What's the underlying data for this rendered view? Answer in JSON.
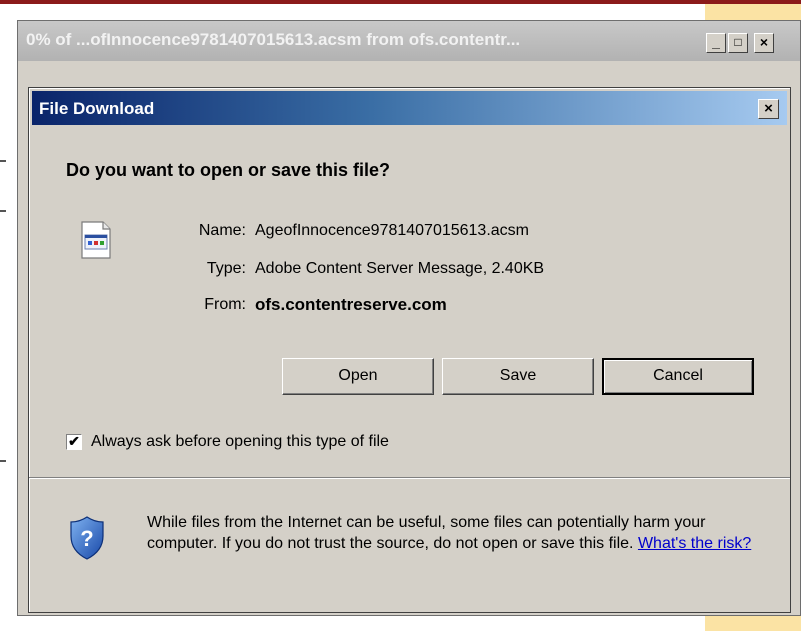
{
  "outer_window": {
    "title": "0% of ...ofInnocence9781407015613.acsm from ofs.contentr...",
    "minimize_label": "_",
    "maximize_label": "□",
    "close_label": "×"
  },
  "dialog": {
    "title": "File Download",
    "close_label": "×",
    "question": "Do you want to open or save this file?",
    "file": {
      "name_label": "Name:",
      "name_value": "AgeofInnocence9781407015613.acsm",
      "type_label": "Type:",
      "type_value": "Adobe Content Server Message, 2.40KB",
      "from_label": "From:",
      "from_value": "ofs.contentreserve.com"
    },
    "buttons": {
      "open": "Open",
      "save": "Save",
      "cancel": "Cancel"
    },
    "checkbox": {
      "label": "Always ask before opening this type of file",
      "checked": true,
      "mark": "✔"
    },
    "warning": {
      "text": "While files from the Internet can be useful, some files can potentially harm your computer. If you do not trust the source, do not open or save this file.",
      "link": "What's the risk?"
    }
  },
  "colors": {
    "dialog_title_start": "#0a246a",
    "dialog_title_end": "#a6caf0",
    "face": "#d4d0c8",
    "link": "#0000cc"
  }
}
